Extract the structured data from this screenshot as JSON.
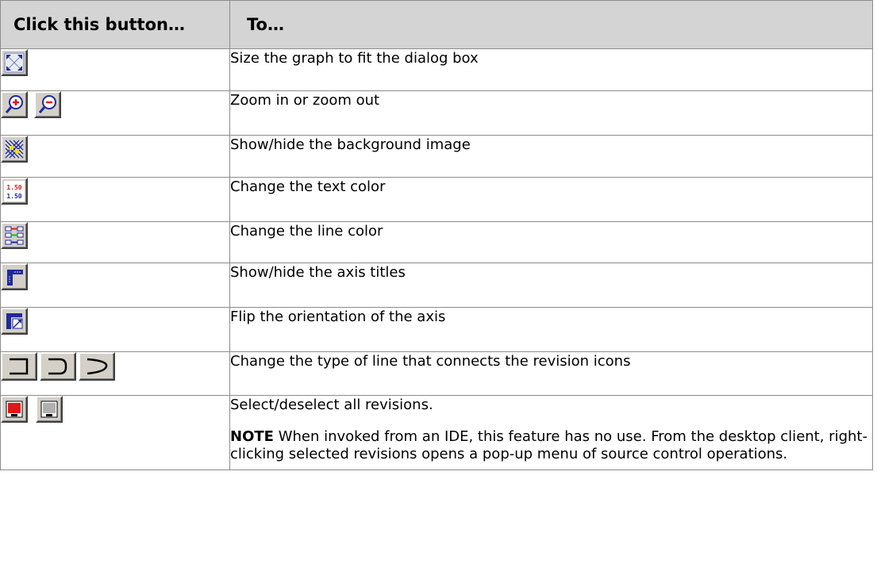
{
  "header": {
    "col1": "Click this button…",
    "col2": "To…"
  },
  "rows": [
    {
      "icons": [
        "fit-to-dialog-icon"
      ],
      "text": "Size the graph to fit the dialog box"
    },
    {
      "icons": [
        "zoom-in-icon",
        "zoom-out-icon"
      ],
      "text": "Zoom in or zoom out"
    },
    {
      "icons": [
        "background-image-icon"
      ],
      "text": "Show/hide the background image"
    },
    {
      "icons": [
        "text-color-icon"
      ],
      "icon_text": "1.50",
      "text": "Change the text color"
    },
    {
      "icons": [
        "line-color-icon"
      ],
      "text": "Change the line color"
    },
    {
      "icons": [
        "axis-titles-icon"
      ],
      "text": "Show/hide the axis titles"
    },
    {
      "icons": [
        "flip-axis-icon"
      ],
      "text": "Flip the orientation of the axis"
    },
    {
      "icons": [
        "square-line-icon",
        "rounded-line-icon",
        "curved-line-icon"
      ],
      "text": "Change the type of line that connects the revision icons"
    },
    {
      "icons": [
        "select-all-icon",
        "deselect-all-icon"
      ],
      "text": "Select/deselect all revisions.",
      "note_label": "NOTE",
      "note_text": "When invoked from an IDE, this feature has no use. From the desktop client, right-clicking selected revisions opens a pop-up menu of source control operations."
    }
  ],
  "colors": {
    "header_bg": "#d4d4d4",
    "button_face": "#d4d0c8",
    "icon_blue": "#1f2a9c",
    "icon_red": "#e01818"
  }
}
